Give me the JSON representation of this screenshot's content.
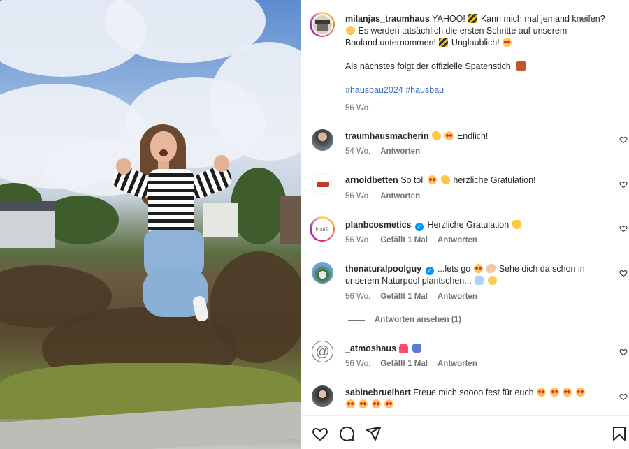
{
  "post": {
    "author": "milanjas_traumhaus",
    "caption_line1": "YAHOO!",
    "caption_line1b": "Kann mich mal jemand kneifen?",
    "caption_line2": "Es werden tatsächlich die ersten Schritte auf unserem",
    "caption_line3": "Bauland unternommen!",
    "caption_line3b": "Unglaublich!",
    "caption_line4": "Als nächstes folgt der offizielle Spatenstich!",
    "hashtags": "#hausbau2024 #hausbau",
    "time": "56 Wo."
  },
  "comments": [
    {
      "user": "traumhausmacherin",
      "text": "Endlich!",
      "time": "54 Wo.",
      "reply": "Antworten"
    },
    {
      "user": "arnoldbetten",
      "text_a": "So toll",
      "text_b": "herzliche Gratulation!",
      "time": "56 Wo.",
      "reply": "Antworten"
    },
    {
      "user": "planbcosmetics",
      "text": "Herzliche Gratulation",
      "time": "56 Wo.",
      "likes": "Gefällt 1 Mal",
      "reply": "Antworten",
      "avatar_text": "PlanB"
    },
    {
      "user": "thenaturalpoolguy",
      "text_a": "...lets go",
      "text_b": "Sehe dich da schon in",
      "text_c": "unserem Naturpool plantschen...",
      "time": "56 Wo.",
      "likes": "Gefällt 1 Mal",
      "reply": "Antworten",
      "view_replies": "Antworten ansehen (1)"
    },
    {
      "user": "_atmoshaus",
      "time": "56 Wo.",
      "likes": "Gefällt 1 Mal",
      "reply": "Antworten"
    },
    {
      "user": "sabinebruelhart",
      "text": "Freue mich soooo fest für euch"
    }
  ],
  "icons": {
    "like": "heart-icon",
    "comment": "comment-icon",
    "share": "share-icon",
    "save": "bookmark-icon"
  },
  "colors": {
    "text": "#262626",
    "secondary": "#737373",
    "hashtag": "#3a6ec6",
    "verified": "#0095f6"
  }
}
